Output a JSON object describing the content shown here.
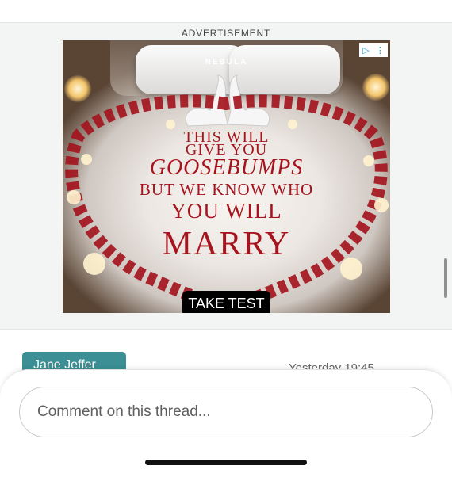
{
  "ad": {
    "label": "ADVERTISEMENT",
    "brand": "NEBULA",
    "headline_lines": [
      "THIS WILL",
      "GIVE YOU",
      "GOOSEBUMPS",
      "BUT WE KNOW WHO",
      "YOU WILL",
      "MARRY"
    ],
    "cta_label": "TAKE TEST",
    "adchoices_icon": "adchoices-icon",
    "menu_icon": "kebab-menu-icon"
  },
  "post": {
    "author": "Jane Jeffer",
    "timestamp": "Yesterday 19:45"
  },
  "comment": {
    "placeholder": "Comment on this thread..."
  },
  "colors": {
    "accent": "#3b8f95",
    "ad_text": "#a8141e"
  }
}
